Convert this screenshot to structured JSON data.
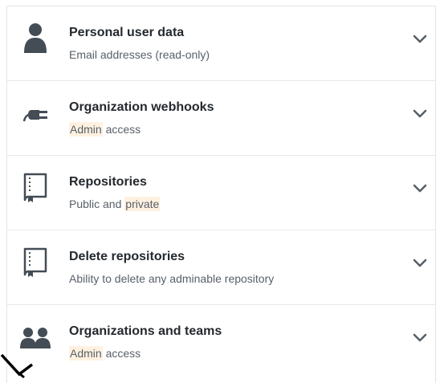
{
  "permissions": [
    {
      "icon": "person-icon",
      "title": "Personal user data",
      "desc_pre": "Email addresses (read-only)",
      "desc_hl": "",
      "desc_post": ""
    },
    {
      "icon": "plug-icon",
      "title": "Organization webhooks",
      "desc_pre": "",
      "desc_hl": "Admin",
      "desc_post": " access"
    },
    {
      "icon": "repo-icon",
      "title": "Repositories",
      "desc_pre": "Public and ",
      "desc_hl": "private",
      "desc_post": ""
    },
    {
      "icon": "repo-icon",
      "title": "Delete repositories",
      "desc_pre": "Ability to delete any adminable repository",
      "desc_hl": "",
      "desc_post": ""
    },
    {
      "icon": "organization-icon",
      "title": "Organizations and teams",
      "desc_pre": "",
      "desc_hl": "Admin",
      "desc_post": " access"
    }
  ],
  "colors": {
    "highlight": "#fff1e0",
    "icon": "#444d56",
    "chevron": "#586069"
  }
}
